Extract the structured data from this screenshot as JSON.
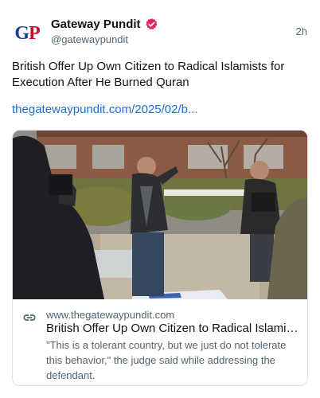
{
  "author": {
    "avatar_text": "GP",
    "display_name": "Gateway Pundit",
    "handle": "@gatewaypundit",
    "verified_badge_icon": "verified-badge-icon",
    "verified_color": "#e0245e"
  },
  "timestamp": "2h",
  "post": {
    "text": "British Offer Up Own Citizen to Radical Islamists for Execution After He Burned Quran",
    "link": "thegatewaypundit.com/2025/02/b..."
  },
  "link_card": {
    "icon": "link-icon",
    "domain": "www.thegatewaypundit.com",
    "title": "British Offer Up Own Citizen to Radical Islamists for Execution After He Burned Quran",
    "description": "\"This is a tolerant country, but we just do not tolerate this behavior,\" the judge said while addressing the defendant."
  },
  "colors": {
    "link": "#1d6fd6",
    "secondary_text": "#536471",
    "brand_blue": "#1d3f8f",
    "brand_red": "#c8102e"
  }
}
